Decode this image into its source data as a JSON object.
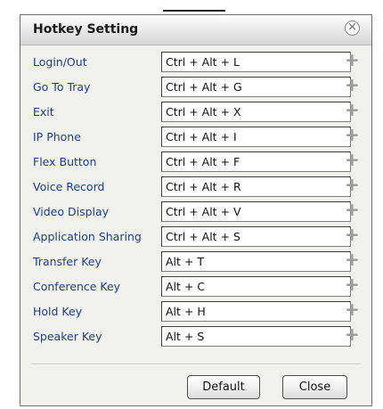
{
  "dialog": {
    "title": "Hotkey Setting",
    "close_icon": "circle-x-icon"
  },
  "hotkeys": [
    {
      "label": "Login/Out",
      "value": "Ctrl + Alt + L"
    },
    {
      "label": "Go To Tray",
      "value": "Ctrl + Alt + G"
    },
    {
      "label": "Exit",
      "value": "Ctrl + Alt + X"
    },
    {
      "label": "IP Phone",
      "value": "Ctrl + Alt + I"
    },
    {
      "label": "Flex Button",
      "value": "Ctrl + Alt + F"
    },
    {
      "label": "Voice Record",
      "value": "Ctrl + Alt + R"
    },
    {
      "label": "Video Display",
      "value": "Ctrl + Alt + V"
    },
    {
      "label": "Application Sharing",
      "value": "Ctrl + Alt + S"
    },
    {
      "label": "Transfer Key",
      "value": "Alt + T"
    },
    {
      "label": "Conference Key",
      "value": "Alt + C"
    },
    {
      "label": "Hold Key",
      "value": "Alt + H"
    },
    {
      "label": "Speaker Key",
      "value": "Alt + S"
    }
  ],
  "add_icon": "plus-icon",
  "buttons": {
    "default_label": "Default",
    "close_label": "Close"
  },
  "colors": {
    "label_text": "#1f3c8c",
    "dialog_bg": "#f1f1ed"
  }
}
